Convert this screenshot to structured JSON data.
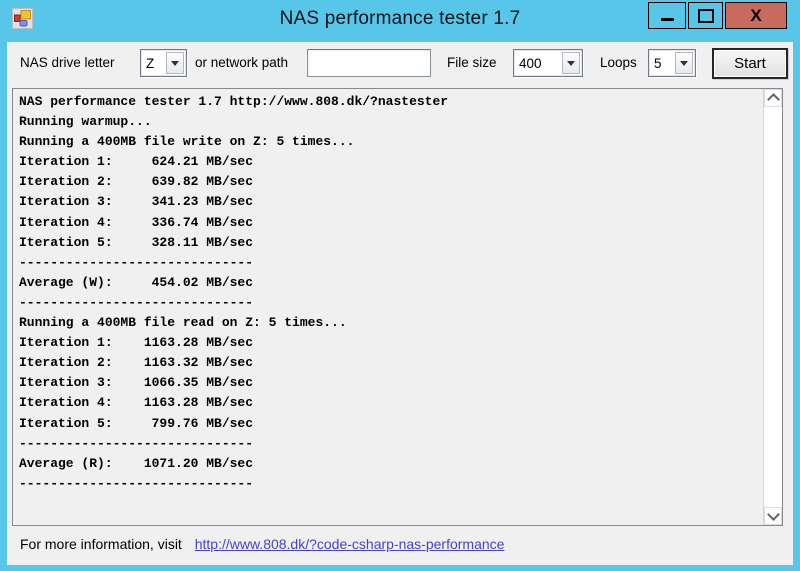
{
  "window": {
    "title": "NAS performance tester 1.7",
    "close_glyph": "X"
  },
  "toolbar": {
    "drive_label": "NAS drive letter",
    "drive_value": "Z",
    "path_label": "or network path",
    "path_value": "",
    "filesize_label": "File size",
    "filesize_value": "400",
    "loops_label": "Loops",
    "loops_value": "5",
    "start_label": "Start"
  },
  "output": {
    "lines": [
      "NAS performance tester 1.7 http://www.808.dk/?nastester",
      "Running warmup...",
      "Running a 400MB file write on Z: 5 times...",
      "Iteration 1:     624.21 MB/sec",
      "Iteration 2:     639.82 MB/sec",
      "Iteration 3:     341.23 MB/sec",
      "Iteration 4:     336.74 MB/sec",
      "Iteration 5:     328.11 MB/sec",
      "------------------------------",
      "Average (W):     454.02 MB/sec",
      "------------------------------",
      "Running a 400MB file read on Z: 5 times...",
      "Iteration 1:    1163.28 MB/sec",
      "Iteration 2:    1163.32 MB/sec",
      "Iteration 3:    1066.35 MB/sec",
      "Iteration 4:    1163.28 MB/sec",
      "Iteration 5:     799.76 MB/sec",
      "------------------------------",
      "Average (R):    1071.20 MB/sec",
      "------------------------------"
    ]
  },
  "footer": {
    "text": "For more information, visit",
    "link_text": "http://www.808.dk/?code-csharp-nas-performance"
  },
  "colors": {
    "frame": "#58c6e8",
    "close_button": "#c96a5f",
    "client_bg": "#f0f0f0",
    "panel_border": "#848890",
    "link": "#4441d3",
    "output_text": "#000000"
  }
}
